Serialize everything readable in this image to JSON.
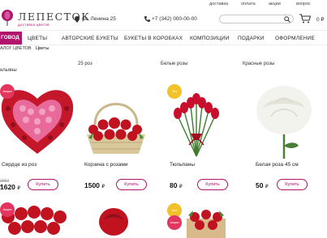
{
  "toplinks": [
    "доставка",
    "оплата",
    "акции",
    "вопрос"
  ],
  "brand": {
    "name": "ЛЕПЕСТОК",
    "tagline": "доставка цветов"
  },
  "header": {
    "address": "ул. Ленина 25",
    "phone": "+7 (342) 000-00-00",
    "search_placeholder": "",
    "cart_total": "0 ₽"
  },
  "nav": {
    "catalog": "ГОВОД",
    "items": [
      "ЦВЕТЫ",
      "АВТОРСКИЕ БУКЕТЫ",
      "БУКЕТЫ В КОРОБКАХ",
      "КОМПОЗИЦИИ",
      "ПОДАРКИ",
      "ОФОРМЛЕНИЕ"
    ]
  },
  "breadcrumb": [
    "АЛОГ ЦВЕТОВ",
    "Цветы"
  ],
  "filters": [
    "25 роз",
    "Белые розы",
    "Красные розы"
  ],
  "filter_row2": "ельяны",
  "products": [
    {
      "name": "Сердце из роз",
      "old_price": "2650 ₽",
      "price": "1620",
      "currency": "₽",
      "badge": "Акция",
      "buy": "Купить"
    },
    {
      "name": "Корзина с розами",
      "old_price": "",
      "price": "1500",
      "currency": "₽",
      "badge": "",
      "buy": "Купить"
    },
    {
      "name": "Тюльпаны",
      "old_price": "",
      "price": "80",
      "currency": "₽",
      "badge": "Хит продаж",
      "buy": "Купить"
    },
    {
      "name": "Белая роза 45 см",
      "old_price": "",
      "price": "50",
      "currency": "₽",
      "badge": "",
      "buy": "Купить"
    }
  ],
  "row2_badges": [
    "Акция",
    "Хит продаж",
    "Акция"
  ],
  "colors": {
    "accent": "#b0146c",
    "sale": "#e2365e",
    "hit": "#f2c22a"
  }
}
